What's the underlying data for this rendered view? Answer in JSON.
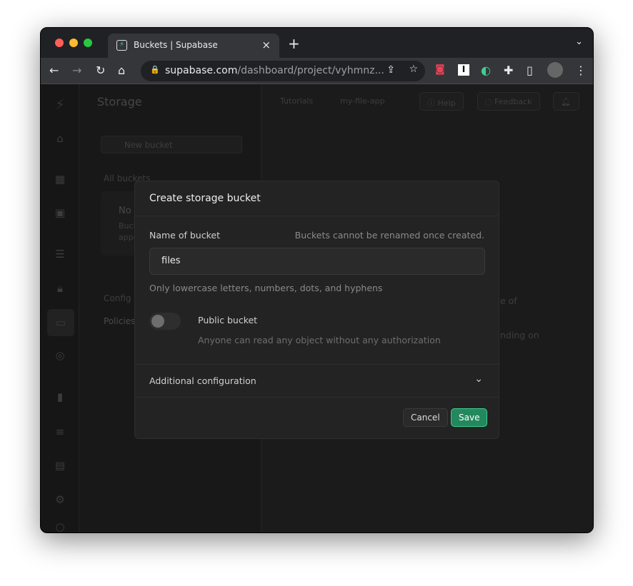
{
  "browser": {
    "tab_title": "Buckets | Supabase",
    "url_host": "supabase.com",
    "url_path": "/dashboard/project/vyhmnz..."
  },
  "app": {
    "section_title": "Storage",
    "breadcrumb": [
      "Tutorials",
      "my-file-app"
    ],
    "help": "Help",
    "feedback": "Feedback",
    "new_bucket": "New bucket",
    "all_buckets": "All buckets",
    "empty_title": "No",
    "empty_line1": "Buck",
    "empty_line2": "appe",
    "configuration": "Config",
    "policies": "Policies",
    "bg_text1": "e of",
    "bg_text2": "nding on"
  },
  "modal": {
    "title": "Create storage bucket",
    "name_label": "Name of bucket",
    "name_hint": "Buckets cannot be renamed once created.",
    "name_value": "files",
    "name_help": "Only lowercase letters, numbers, dots, and hyphens",
    "public_label": "Public bucket",
    "public_desc": "Anyone can read any object without any authorization",
    "public_enabled": false,
    "additional": "Additional configuration",
    "cancel": "Cancel",
    "save": "Save"
  },
  "colors": {
    "accent": "#24b47e"
  }
}
